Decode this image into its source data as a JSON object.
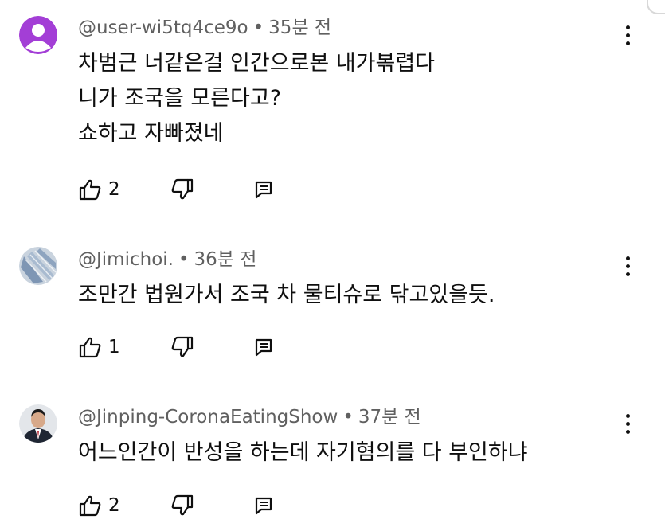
{
  "comments": [
    {
      "handle": "@user-wi5tq4ce9o",
      "time": "35분 전",
      "lines": [
        "차범근  너같은걸 인간으로본 내가볶렵다",
        "니가 조국을 모른다고?",
        "쇼하고 자빠졌네"
      ],
      "likes": "2",
      "avatar": "default-person-purple"
    },
    {
      "handle": "@Jimichoi.",
      "time": "36분 전",
      "lines": [
        "조만간 법원가서 조국 차 물티슈로 닦고있을듯."
      ],
      "likes": "1",
      "avatar": "photo-blue-striped-shirt"
    },
    {
      "handle": "@Jinping-CoronaEatingShow",
      "time": "37분 전",
      "lines": [
        "어느인간이 반성을 하는데 자기혐의를 다 부인하냐"
      ],
      "likes": "2",
      "avatar": "photo-man-in-suit"
    }
  ],
  "icons": {
    "like": "thumbs-up-icon",
    "dislike": "thumbs-down-icon",
    "reply": "reply-comment-icon",
    "menu": "more-vertical-icon"
  },
  "colors": {
    "avatar_purple": "#a33ed6",
    "meta_text": "#606060",
    "body_text": "#0f0f0f"
  }
}
